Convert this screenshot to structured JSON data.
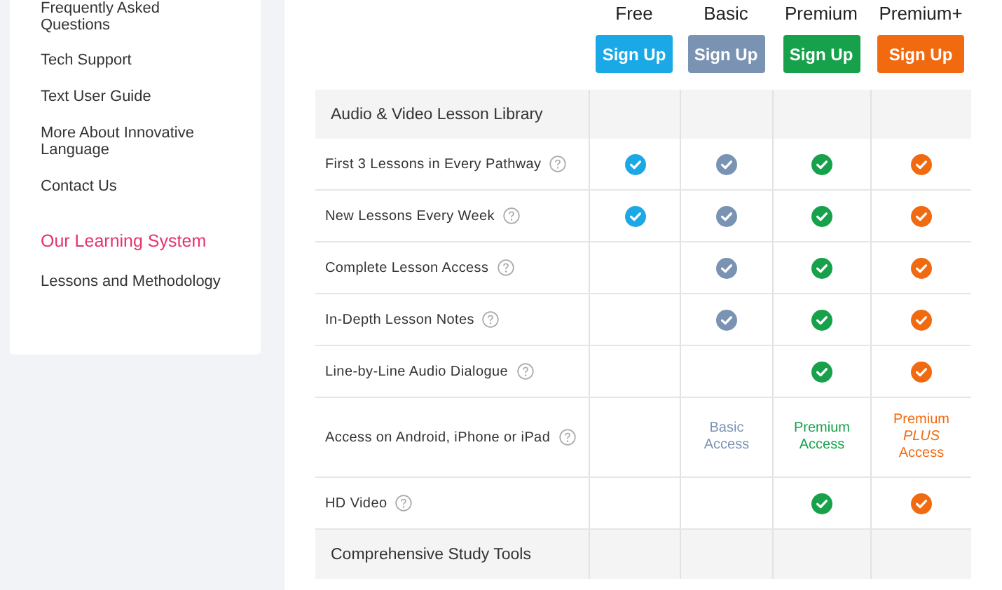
{
  "sidebar": {
    "items": [
      {
        "label": "Frequently Asked Questions",
        "kind": "link"
      },
      {
        "label": "Tech Support",
        "kind": "link"
      },
      {
        "label": "Text User Guide",
        "kind": "link"
      },
      {
        "label": "More About Innovative Language",
        "kind": "link"
      },
      {
        "label": "Contact Us",
        "kind": "link"
      },
      {
        "label": "Our Learning System",
        "kind": "heading"
      },
      {
        "label": "Lessons and Methodology",
        "kind": "link"
      }
    ]
  },
  "plans": [
    {
      "name": "Free",
      "button": "Sign Up",
      "color": "#1aa9e6"
    },
    {
      "name": "Basic",
      "button": "Sign Up",
      "color": "#7a93b3"
    },
    {
      "name": "Premium",
      "button": "Sign Up",
      "color": "#16a14a"
    },
    {
      "name": "Premium+",
      "button": "Sign Up",
      "color": "#f26a10"
    }
  ],
  "rows": [
    {
      "kind": "section",
      "label": "Audio & Video Lesson Library"
    },
    {
      "kind": "feature",
      "label": "First 3 Lessons in Every Pathway",
      "cells": [
        {
          "kind": "check"
        },
        {
          "kind": "check"
        },
        {
          "kind": "check"
        },
        {
          "kind": "check"
        }
      ]
    },
    {
      "kind": "feature",
      "label": "New Lessons Every Week",
      "cells": [
        {
          "kind": "check"
        },
        {
          "kind": "check"
        },
        {
          "kind": "check"
        },
        {
          "kind": "check"
        }
      ]
    },
    {
      "kind": "feature",
      "label": "Complete Lesson Access",
      "cells": [
        {
          "kind": "empty"
        },
        {
          "kind": "check"
        },
        {
          "kind": "check"
        },
        {
          "kind": "check"
        }
      ]
    },
    {
      "kind": "feature",
      "label": "In-Depth Lesson Notes",
      "cells": [
        {
          "kind": "empty"
        },
        {
          "kind": "check"
        },
        {
          "kind": "check"
        },
        {
          "kind": "check"
        }
      ]
    },
    {
      "kind": "feature",
      "label": "Line-by-Line Audio Dialogue",
      "cells": [
        {
          "kind": "empty"
        },
        {
          "kind": "empty"
        },
        {
          "kind": "check"
        },
        {
          "kind": "check"
        }
      ]
    },
    {
      "kind": "feature",
      "label": "Access on Android, iPhone or iPad",
      "cells": [
        {
          "kind": "empty"
        },
        {
          "kind": "text",
          "text": "Basic Access"
        },
        {
          "kind": "text",
          "text": "Premium Access"
        },
        {
          "kind": "text",
          "text": "Premium *PLUS* Access"
        }
      ]
    },
    {
      "kind": "feature",
      "label": "HD Video",
      "cells": [
        {
          "kind": "empty"
        },
        {
          "kind": "empty"
        },
        {
          "kind": "check"
        },
        {
          "kind": "check"
        }
      ]
    },
    {
      "kind": "section",
      "label": "Comprehensive Study Tools"
    }
  ]
}
